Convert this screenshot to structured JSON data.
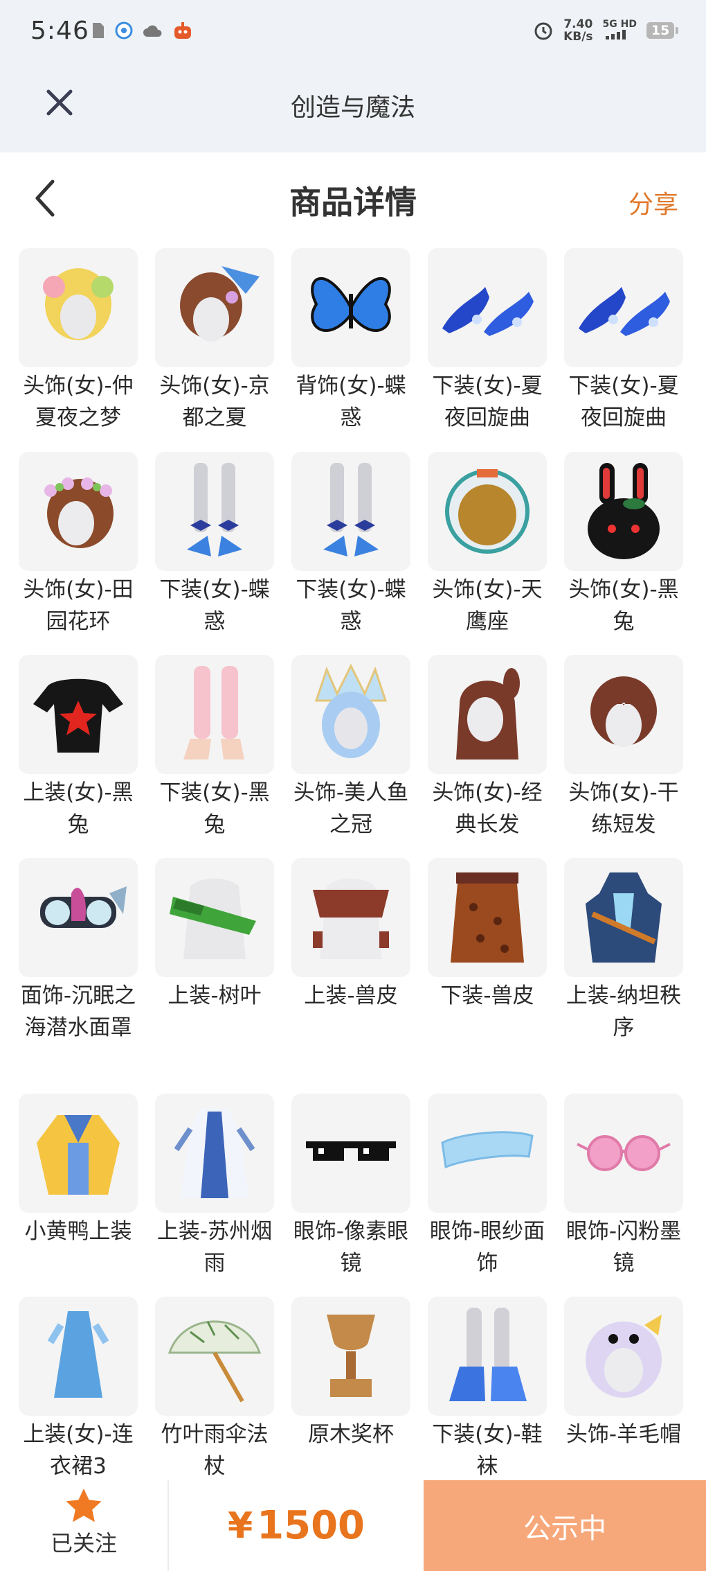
{
  "status_bar": {
    "time": "5:46",
    "speed_value": "7.40",
    "speed_unit": "KB/s",
    "network": "5G HD",
    "battery": "15"
  },
  "app_header": {
    "title": "创造与魔法"
  },
  "page_header": {
    "title": "商品详情",
    "share_label": "分享"
  },
  "items": [
    {
      "name": "头饰(女)-仲夏夜之梦",
      "icon": "yellow-hair-headwear-icon"
    },
    {
      "name": "头饰(女)-京都之夏",
      "icon": "brown-hair-fan-headwear-icon"
    },
    {
      "name": "背饰(女)-蝶惑",
      "icon": "blue-butterfly-wings-icon"
    },
    {
      "name": "下装(女)-夏夜回旋曲",
      "icon": "blue-heels-icon"
    },
    {
      "name": "下装(女)-夏夜回旋曲",
      "icon": "blue-heels-icon"
    },
    {
      "name": "头饰(女)-田园花环",
      "icon": "flower-wreath-hair-icon"
    },
    {
      "name": "下装(女)-蝶惑",
      "icon": "ribbon-heels-legs-icon"
    },
    {
      "name": "下装(女)-蝶惑",
      "icon": "ribbon-heels-legs-icon"
    },
    {
      "name": "头饰(女)-天鹰座",
      "icon": "gold-helmet-icon"
    },
    {
      "name": "头饰(女)-黑兔",
      "icon": "black-bunny-hood-icon"
    },
    {
      "name": "上装(女)-黑兔",
      "icon": "black-star-top-icon"
    },
    {
      "name": "下装(女)-黑兔",
      "icon": "pink-stockings-icon"
    },
    {
      "name": "头饰-美人鱼之冠",
      "icon": "mermaid-crown-icon"
    },
    {
      "name": "头饰(女)-经典长发",
      "icon": "long-hair-icon"
    },
    {
      "name": "头饰(女)-干练短发",
      "icon": "short-hair-icon"
    },
    {
      "name": "面饰-沉眠之海潜水面罩",
      "icon": "diving-mask-icon"
    },
    {
      "name": "上装-树叶",
      "icon": "leaf-top-icon"
    },
    {
      "name": "上装-兽皮",
      "icon": "hide-top-icon"
    },
    {
      "name": "下装-兽皮",
      "icon": "leopard-skirt-icon"
    },
    {
      "name": "上装-纳坦秩序",
      "icon": "armor-suit-icon"
    },
    {
      "name": "小黄鸭上装",
      "icon": "yellow-duck-coat-icon"
    },
    {
      "name": "上装-苏州烟雨",
      "icon": "blue-white-dress-icon"
    },
    {
      "name": "眼饰-像素眼镜",
      "icon": "pixel-glasses-icon"
    },
    {
      "name": "眼饰-眼纱面饰",
      "icon": "eye-veil-icon"
    },
    {
      "name": "眼饰-闪粉墨镜",
      "icon": "pink-sunglasses-icon"
    },
    {
      "name": "上装(女)-连衣裙3",
      "icon": "blue-dress-icon"
    },
    {
      "name": "竹叶雨伞法杖",
      "icon": "bamboo-umbrella-icon"
    },
    {
      "name": "原木奖杯",
      "icon": "wooden-trophy-icon"
    },
    {
      "name": "下装(女)-鞋袜",
      "icon": "blue-shoes-icon"
    },
    {
      "name": "头饰-羊毛帽",
      "icon": "sheep-hat-icon"
    }
  ],
  "bottom_bar": {
    "follow_label": "已关注",
    "currency": "¥",
    "price": "1500",
    "status_label": "公示中"
  },
  "colors": {
    "accent": "#e8741d",
    "status_button": "#f7a87a",
    "header_bg": "#eff3f7"
  }
}
